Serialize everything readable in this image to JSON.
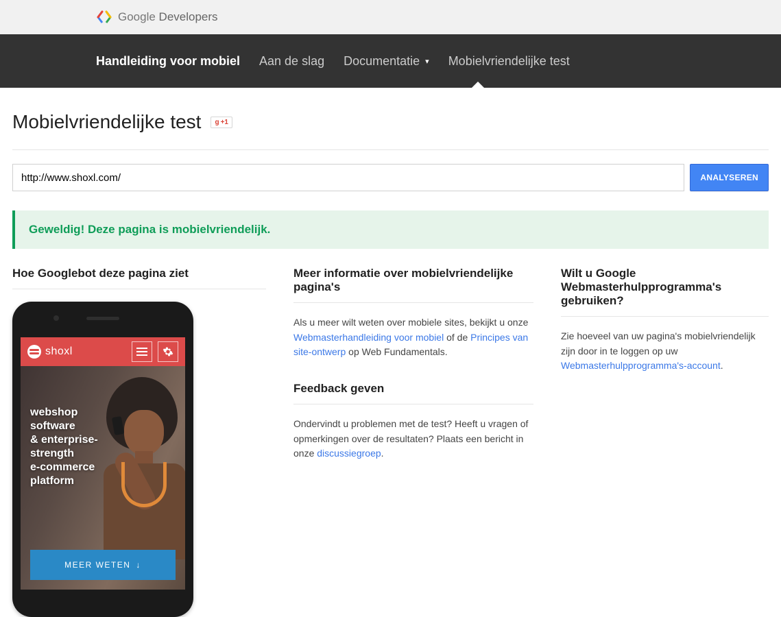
{
  "topbar": {
    "brand_google": "Google",
    "brand_dev": " Developers"
  },
  "nav": {
    "items": [
      {
        "label": "Handleiding voor mobiel"
      },
      {
        "label": "Aan de slag"
      },
      {
        "label": "Documentatie"
      },
      {
        "label": "Mobielvriendelijke test"
      }
    ]
  },
  "page": {
    "title": "Mobielvriendelijke test",
    "gplus": "+1"
  },
  "form": {
    "url_value": "http://www.shoxl.com/",
    "analyze_label": "ANALYSEREN"
  },
  "result": {
    "message": "Geweldig! Deze pagina is mobielvriendelijk."
  },
  "col1": {
    "heading": "Hoe Googlebot deze pagina ziet"
  },
  "phone": {
    "brand": "shoxl",
    "hero_lines": "webshop\nsoftware\n& enterprise-\nstrength\ne-commerce\nplatform",
    "cta": "MEER WETEN"
  },
  "col2": {
    "info_heading": "Meer informatie over mobielvriendelijke pagina's",
    "info_body_1": "Als u meer wilt weten over mobiele sites, bekijkt u onze ",
    "info_link_1": "Webmasterhandleiding voor mobiel",
    "info_body_2": " of de ",
    "info_link_2": "Principes van site-ontwerp",
    "info_body_3": " op Web Fundamentals.",
    "feedback_heading": "Feedback geven",
    "feedback_body_1": "Ondervindt u problemen met de test? Heeft u vragen of opmerkingen over de resultaten? Plaats een bericht in onze ",
    "feedback_link": "discussiegroep",
    "feedback_body_2": "."
  },
  "col3": {
    "heading": "Wilt u Google Webmasterhulpprogramma's gebruiken?",
    "body_1": "Zie hoeveel van uw pagina's mobielvriendelijk zijn door in te loggen op uw ",
    "link": "Webmasterhulpprogramma's-account",
    "body_2": "."
  }
}
